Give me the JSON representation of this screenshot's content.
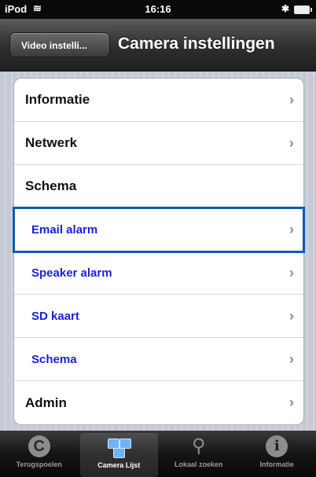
{
  "status": {
    "carrier": "iPod",
    "time": "16:16"
  },
  "nav": {
    "back_label": "Video instelli...",
    "title": "Camera instellingen"
  },
  "menu": {
    "items": [
      {
        "label": "Informatie",
        "sub": false
      },
      {
        "label": "Netwerk",
        "sub": false
      },
      {
        "label": "Schema",
        "sub": false
      },
      {
        "label": "Email alarm",
        "sub": true,
        "highlighted": true
      },
      {
        "label": "Speaker alarm",
        "sub": true
      },
      {
        "label": "SD kaart",
        "sub": true
      },
      {
        "label": "Schema",
        "sub": true
      },
      {
        "label": "Admin",
        "sub": false
      }
    ],
    "chevron": "›"
  },
  "tabs": [
    {
      "label": "Terugspoelen",
      "icon": "replay-icon"
    },
    {
      "label": "Camera Lijst",
      "icon": "camera-list-icon",
      "active": true
    },
    {
      "label": "Lokaal zoeken",
      "icon": "search-icon"
    },
    {
      "label": "Informatie",
      "icon": "info-icon"
    }
  ],
  "colors": {
    "sub_item_text": "#1a22e0",
    "highlight_border": "#0a5ab8"
  }
}
